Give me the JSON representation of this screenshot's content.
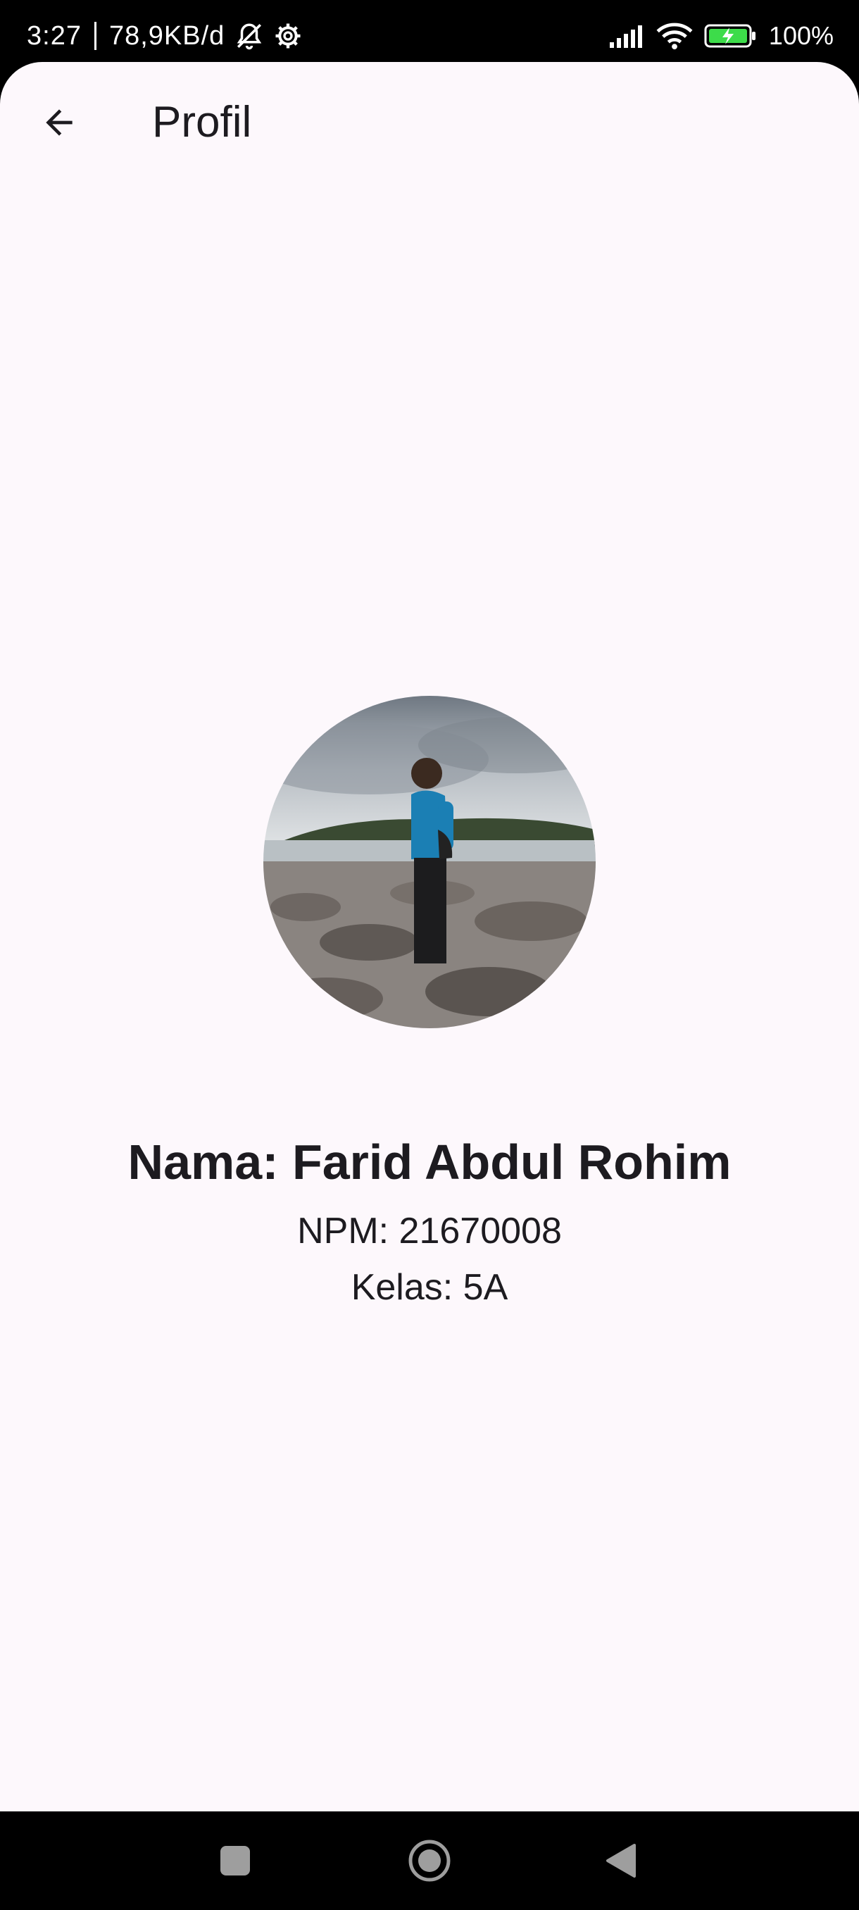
{
  "status_bar": {
    "time": "3:27",
    "network_speed": "78,9KB/d",
    "battery": "100%",
    "icons": [
      "notifications-off-icon",
      "settings-gear-icon",
      "signal-icon",
      "wifi-icon",
      "battery-charging-icon"
    ]
  },
  "app_bar": {
    "title": "Profil",
    "back_icon": "arrow-back-icon"
  },
  "profile": {
    "name": "Nama: Farid Abdul Rohim",
    "npm": "NPM: 21670008",
    "kelas": "Kelas: 5A"
  },
  "nav_bar": {
    "icons": [
      "recent-apps-icon",
      "home-icon",
      "back-icon"
    ]
  },
  "colors": {
    "background": "#fdf8fc",
    "text": "#1d1b20",
    "system_bar": "#000000",
    "battery_fill": "#3ddc4a"
  }
}
